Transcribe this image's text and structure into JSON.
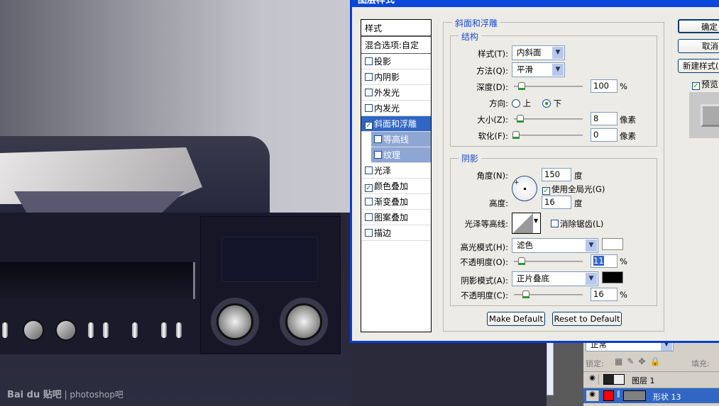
{
  "canvas": {
    "watermark_brand": "Bai du 贴吧",
    "watermark_text": "photoshop吧"
  },
  "dialog": {
    "title": "图层样式",
    "styles_header": "样式",
    "blend_options": "混合选项:自定",
    "styles": [
      {
        "label": "投影",
        "checked": false
      },
      {
        "label": "内阴影",
        "checked": false
      },
      {
        "label": "外发光",
        "checked": false
      },
      {
        "label": "内发光",
        "checked": false
      },
      {
        "label": "斜面和浮雕",
        "checked": true,
        "selected": true
      },
      {
        "label": "等高线",
        "checked": false,
        "sub": true
      },
      {
        "label": "纹理",
        "checked": false,
        "sub": true
      },
      {
        "label": "光泽",
        "checked": false
      },
      {
        "label": "颜色叠加",
        "checked": true
      },
      {
        "label": "渐变叠加",
        "checked": false
      },
      {
        "label": "图案叠加",
        "checked": false
      },
      {
        "label": "描边",
        "checked": false
      }
    ],
    "section_title": "斜面和浮雕",
    "structure": {
      "title": "结构",
      "style_label": "样式(T):",
      "style_value": "内斜面",
      "technique_label": "方法(Q):",
      "technique_value": "平滑",
      "depth_label": "深度(D):",
      "depth_value": "100",
      "depth_unit": "%",
      "direction_label": "方向:",
      "direction_up": "上",
      "direction_down": "下",
      "direction_selected": "下",
      "size_label": "大小(Z):",
      "size_value": "8",
      "size_unit": "像素",
      "soften_label": "软化(F):",
      "soften_value": "0",
      "soften_unit": "像素"
    },
    "shading": {
      "title": "阴影",
      "angle_label": "角度(N):",
      "angle_value": "150",
      "angle_unit": "度",
      "global_light_label": "使用全局光(G)",
      "global_light_checked": true,
      "altitude_label": "高度:",
      "altitude_value": "16",
      "altitude_unit": "度",
      "gloss_contour_label": "光泽等高线:",
      "antialias_label": "消除锯齿(L)",
      "antialias_checked": false,
      "highlight_mode_label": "高光模式(H):",
      "highlight_mode_value": "滤色",
      "highlight_color": "#ffffff",
      "highlight_opacity_label": "不透明度(O):",
      "highlight_opacity_value": "11",
      "highlight_opacity_unit": "%",
      "shadow_mode_label": "阴影模式(A):",
      "shadow_mode_value": "正片叠底",
      "shadow_color": "#000000",
      "shadow_opacity_label": "不透明度(C):",
      "shadow_opacity_value": "16",
      "shadow_opacity_unit": "%"
    },
    "make_default": "Make Default",
    "reset_default": "Reset to Default",
    "ok": "确定",
    "cancel": "取消",
    "new_style": "新建样式(",
    "preview_label": "预览",
    "preview_checked": true
  },
  "layers": {
    "blend_mode": "正常",
    "lock_label": "锁定:",
    "fill_label": "填充:",
    "items": [
      {
        "name": "图层 1",
        "visible": true
      },
      {
        "name": "形状 13",
        "visible": true,
        "selected": true,
        "color": "#ff0000"
      }
    ]
  }
}
